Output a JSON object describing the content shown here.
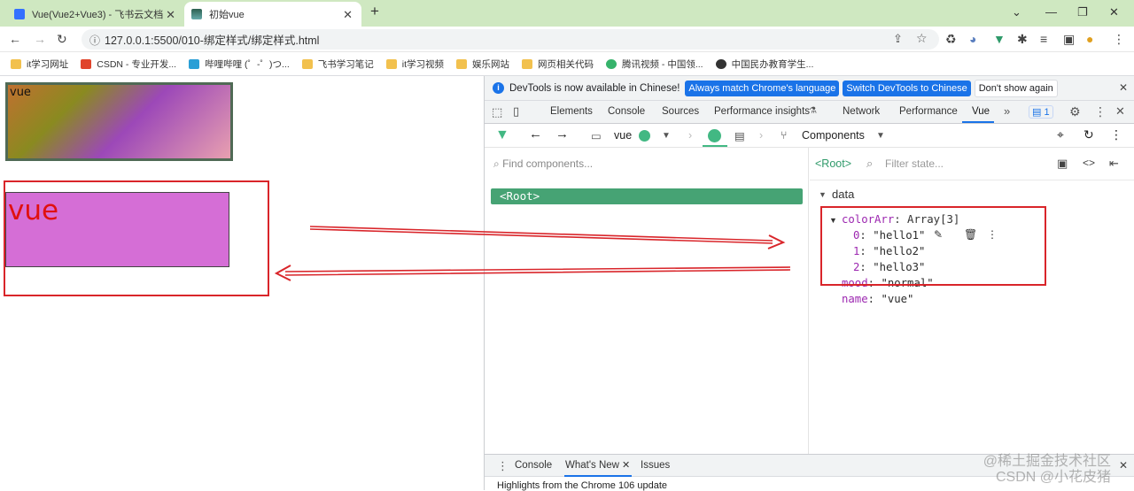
{
  "browser": {
    "tabs": [
      {
        "title": "Vue(Vue2+Vue3) - 飞书云文档",
        "active": false
      },
      {
        "title": "初始vue",
        "active": true
      }
    ],
    "new_tab": "+",
    "window_buttons": {
      "collapse": "⌄",
      "minimize": "—",
      "restore": "❐",
      "close": "✕"
    },
    "url": "127.0.0.1:5500/010-绑定样式/绑定样式.html"
  },
  "bookmarks": [
    {
      "label": "it学习网址",
      "color": "#f2c14e"
    },
    {
      "label": "CSDN - 专业开发...",
      "color": "#e0442b"
    },
    {
      "label": "哔哩哔哩 (゜-゜)つ...",
      "color": "#2a9fd6"
    },
    {
      "label": "飞书学习笔记",
      "color": "#f2c14e"
    },
    {
      "label": "it学习视频",
      "color": "#f2c14e"
    },
    {
      "label": "娱乐网站",
      "color": "#f2c14e"
    },
    {
      "label": "网页相关代码",
      "color": "#f2c14e"
    },
    {
      "label": "腾讯视频 - 中国领...",
      "color": "#36b36b"
    },
    {
      "label": "中国民办教育学生...",
      "color": "#333333"
    }
  ],
  "page": {
    "box1_text": "vue",
    "box2_text": "vue"
  },
  "devtools": {
    "info_text": "DevTools is now available in Chinese!",
    "btn_always": "Always match Chrome's language",
    "btn_switch": "Switch DevTools to Chinese",
    "btn_dont": "Don't show again",
    "tabs": [
      "Elements",
      "Console",
      "Sources",
      "Performance insights",
      "Network",
      "Performance",
      "Vue"
    ],
    "issues_count": "1",
    "vue_app": "vue",
    "components_label": "Components",
    "find_placeholder": "Find components...",
    "root_row": "<Root>",
    "root_tag": "<Root>",
    "filter_placeholder": "Filter state...",
    "data_section": "data",
    "state": {
      "colorArr_key": "colorArr",
      "colorArr_value": "Array[3]",
      "items": [
        {
          "index": "0",
          "value": "\"hello1\""
        },
        {
          "index": "1",
          "value": "\"hello2\""
        },
        {
          "index": "2",
          "value": "\"hello3\""
        }
      ],
      "mood_key": "mood",
      "mood_value": "\"normal\"",
      "name_key": "name",
      "name_value": "\"vue\""
    },
    "bottom_tabs": [
      "Console",
      "What's New",
      "Issues"
    ],
    "highlights": "Highlights from the Chrome 106 update"
  },
  "watermark": {
    "line1": "@稀土掘金技术社区",
    "line2": "CSDN @小花皮猪"
  }
}
